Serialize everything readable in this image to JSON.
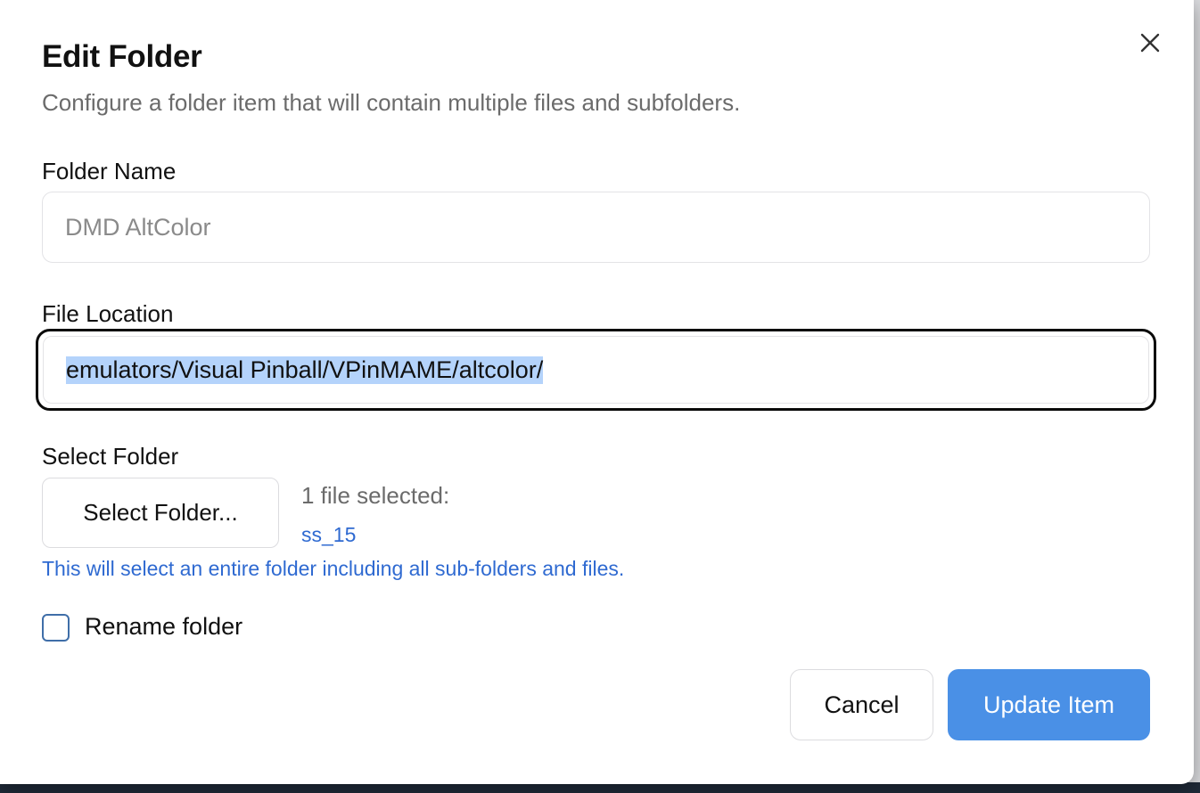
{
  "dialog": {
    "title": "Edit Folder",
    "subtitle": "Configure a folder item that will contain multiple files and subfolders.",
    "close_icon": "close-icon"
  },
  "folder_name": {
    "label": "Folder Name",
    "value": "DMD AltColor"
  },
  "file_location": {
    "label": "File Location",
    "value": "emulators/Visual Pinball/VPinMAME/altcolor/"
  },
  "select_folder": {
    "label": "Select Folder",
    "button_label": "Select Folder...",
    "file_count": "1 file selected:",
    "file_name": "ss_15",
    "hint": "This will select an entire folder including all sub-folders and files."
  },
  "rename_folder": {
    "label": "Rename folder",
    "checked": false
  },
  "actions": {
    "cancel_label": "Cancel",
    "update_label": "Update Item"
  },
  "colors": {
    "primary": "#4a90e6",
    "link": "#2f6ad1",
    "selection": "#b4d3fb"
  }
}
